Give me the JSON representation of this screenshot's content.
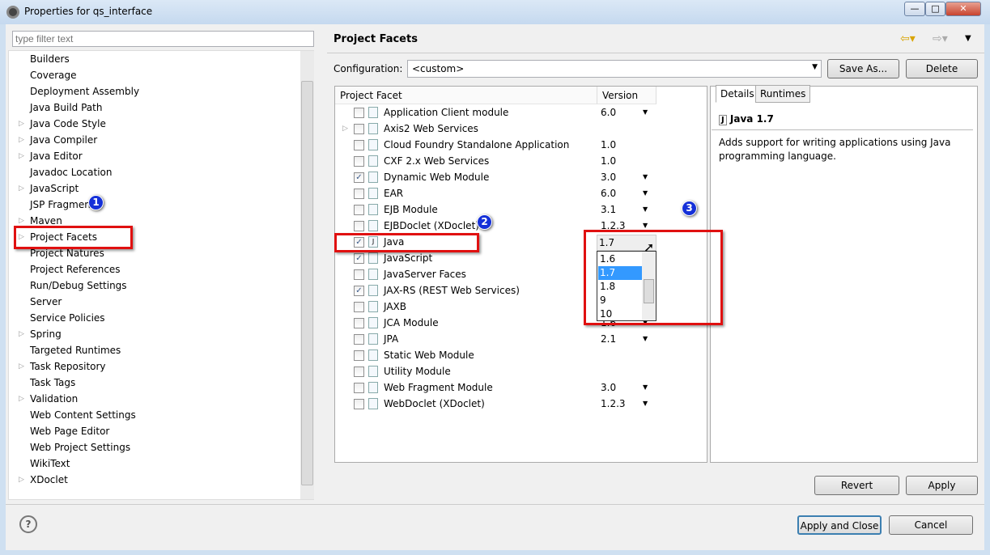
{
  "window": {
    "title": "Properties for qs_interface",
    "min": "—",
    "max": "□",
    "close": "✕"
  },
  "filter": {
    "placeholder": "type filter text"
  },
  "tree": [
    {
      "label": "Builders",
      "exp": false
    },
    {
      "label": "Coverage",
      "exp": false
    },
    {
      "label": "Deployment Assembly",
      "exp": false
    },
    {
      "label": "Java Build Path",
      "exp": false
    },
    {
      "label": "Java Code Style",
      "exp": true
    },
    {
      "label": "Java Compiler",
      "exp": true
    },
    {
      "label": "Java Editor",
      "exp": true
    },
    {
      "label": "Javadoc Location",
      "exp": false
    },
    {
      "label": "JavaScript",
      "exp": true
    },
    {
      "label": "JSP Fragment",
      "exp": false
    },
    {
      "label": "Maven",
      "exp": true
    },
    {
      "label": "Project Facets",
      "exp": true,
      "selected": true
    },
    {
      "label": "Project Natures",
      "exp": false
    },
    {
      "label": "Project References",
      "exp": false
    },
    {
      "label": "Run/Debug Settings",
      "exp": false
    },
    {
      "label": "Server",
      "exp": false
    },
    {
      "label": "Service Policies",
      "exp": false
    },
    {
      "label": "Spring",
      "exp": true
    },
    {
      "label": "Targeted Runtimes",
      "exp": false
    },
    {
      "label": "Task Repository",
      "exp": true
    },
    {
      "label": "Task Tags",
      "exp": false
    },
    {
      "label": "Validation",
      "exp": true
    },
    {
      "label": "Web Content Settings",
      "exp": false
    },
    {
      "label": "Web Page Editor",
      "exp": false
    },
    {
      "label": "Web Project Settings",
      "exp": false
    },
    {
      "label": "WikiText",
      "exp": false
    },
    {
      "label": "XDoclet",
      "exp": true
    }
  ],
  "page": {
    "title": "Project Facets",
    "config_label": "Configuration:",
    "config_value": "<custom>",
    "save_as": "Save As...",
    "delete": "Delete",
    "revert": "Revert",
    "apply": "Apply"
  },
  "facets": {
    "col_facet": "Project Facet",
    "col_version": "Version",
    "rows": [
      {
        "name": "Application Client module",
        "checked": false,
        "version": "6.0",
        "dd": true
      },
      {
        "name": "Axis2 Web Services",
        "checked": false,
        "version": "",
        "dd": false,
        "exp": true
      },
      {
        "name": "Cloud Foundry Standalone Application",
        "checked": false,
        "version": "1.0",
        "dd": false
      },
      {
        "name": "CXF 2.x Web Services",
        "checked": false,
        "version": "1.0",
        "dd": false
      },
      {
        "name": "Dynamic Web Module",
        "checked": true,
        "version": "3.0",
        "dd": true
      },
      {
        "name": "EAR",
        "checked": false,
        "version": "6.0",
        "dd": true
      },
      {
        "name": "EJB Module",
        "checked": false,
        "version": "3.1",
        "dd": true
      },
      {
        "name": "EJBDoclet (XDoclet)",
        "checked": false,
        "version": "1.2.3",
        "dd": true
      },
      {
        "name": "Java",
        "checked": true,
        "version": "1.7",
        "dd": true
      },
      {
        "name": "JavaScript",
        "checked": true,
        "version": "",
        "dd": false
      },
      {
        "name": "JavaServer Faces",
        "checked": false,
        "version": "",
        "dd": false
      },
      {
        "name": "JAX-RS (REST Web Services)",
        "checked": true,
        "version": "",
        "dd": false
      },
      {
        "name": "JAXB",
        "checked": false,
        "version": "",
        "dd": false
      },
      {
        "name": "JCA Module",
        "checked": false,
        "version": "1.6",
        "dd": true
      },
      {
        "name": "JPA",
        "checked": false,
        "version": "2.1",
        "dd": true
      },
      {
        "name": "Static Web Module",
        "checked": false,
        "version": "",
        "dd": false
      },
      {
        "name": "Utility Module",
        "checked": false,
        "version": "",
        "dd": false
      },
      {
        "name": "Web Fragment Module",
        "checked": false,
        "version": "3.0",
        "dd": true
      },
      {
        "name": "WebDoclet (XDoclet)",
        "checked": false,
        "version": "1.2.3",
        "dd": true
      }
    ]
  },
  "version_dropdown": {
    "options": [
      "1.6",
      "1.7",
      "1.8",
      "9",
      "10"
    ],
    "selected": "1.7"
  },
  "details": {
    "tab_details": "Details",
    "tab_runtimes": "Runtimes",
    "title": "Java 1.7",
    "description": "Adds support for writing applications using Java programming language."
  },
  "badges": [
    "1",
    "2",
    "3"
  ],
  "footer": {
    "help": "?",
    "apply_close": "Apply and Close",
    "cancel": "Cancel"
  },
  "colors": {
    "annotation_red": "#e01010",
    "badge_blue": "#1530d8",
    "selection": "#3399ff"
  }
}
